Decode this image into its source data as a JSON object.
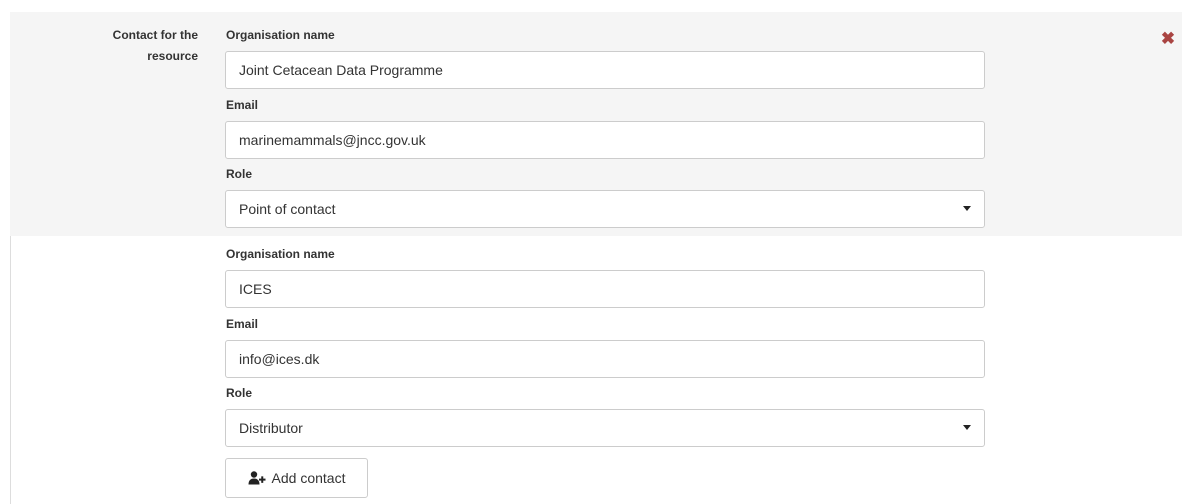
{
  "contact_section": {
    "label": "Contact for the resource",
    "remove_icon": "remove-icon"
  },
  "labels": {
    "organisation_name": "Organisation name",
    "email": "Email",
    "role": "Role"
  },
  "contacts": [
    {
      "organisation_name": "Joint Cetacean Data Programme",
      "email": "marinemammals@jncc.gov.uk",
      "role": "Point of contact"
    },
    {
      "organisation_name": "ICES",
      "email": "info@ices.dk",
      "role": "Distributor"
    }
  ],
  "add_contact": {
    "label": "Add contact",
    "icon": "add-user-icon"
  },
  "colors": {
    "highlight_background": "#f5f5f5",
    "remove_icon": "#a94442",
    "border": "#cccccc"
  }
}
